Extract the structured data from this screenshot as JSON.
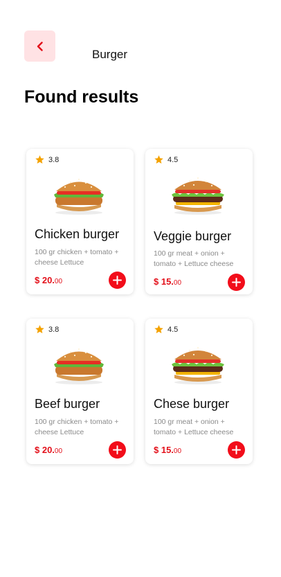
{
  "header": {
    "title": "Burger"
  },
  "section_title": "Found results",
  "colors": {
    "accent": "#f20d1a",
    "back_bg": "#ffe2e4",
    "star": "#f4a200",
    "muted": "#8a8a8a"
  },
  "products": [
    {
      "rating": "3.8",
      "name": "Chicken burger",
      "desc": "100 gr chicken + tomato + cheese  Lettuce",
      "price_main": "$ 20.",
      "price_cents": "00",
      "patty": "chicken"
    },
    {
      "rating": "4.5",
      "name": "Veggie burger",
      "desc": "100 gr meat + onion + tomato + Lettuce cheese",
      "price_main": "$ 15.",
      "price_cents": "00",
      "patty": "beef"
    },
    {
      "rating": "3.8",
      "name": "Beef burger",
      "desc": "100 gr chicken + tomato + cheese  Lettuce",
      "price_main": "$ 20.",
      "price_cents": "00",
      "patty": "chicken"
    },
    {
      "rating": "4.5",
      "name": "Chese burger",
      "desc": "100 gr meat + onion + tomato + Lettuce cheese",
      "price_main": "$ 15.",
      "price_cents": "00",
      "patty": "beef"
    }
  ]
}
